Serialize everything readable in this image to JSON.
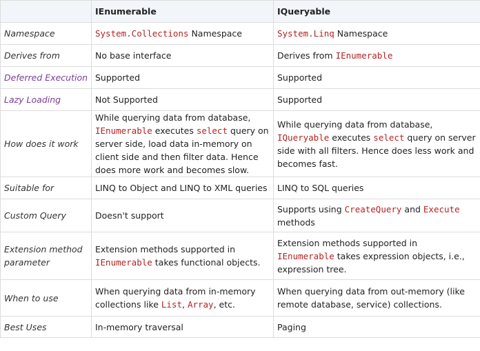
{
  "header": {
    "col0": "",
    "col1": "IEnumerable",
    "col2": "IQueryable"
  },
  "rows": [
    {
      "label": "Namespace",
      "c1": [
        {
          "t": "System.Collections",
          "code": true
        },
        {
          "t": " Namespace"
        }
      ],
      "c2": [
        {
          "t": "System.Linq",
          "code": true
        },
        {
          "t": " Namespace"
        }
      ]
    },
    {
      "label": "Derives from",
      "c1": [
        {
          "t": "No base interface"
        }
      ],
      "c2": [
        {
          "t": "Derives from "
        },
        {
          "t": "IEnumerable",
          "code": true
        }
      ]
    },
    {
      "label": "Deferred Execution",
      "c1": [
        {
          "t": "Supported"
        }
      ],
      "c2": [
        {
          "t": "Supported"
        }
      ]
    },
    {
      "label": "Lazy Loading",
      "c1": [
        {
          "t": "Not Supported"
        }
      ],
      "c2": [
        {
          "t": "Supported"
        }
      ]
    },
    {
      "label": "How does it work",
      "c1": [
        {
          "t": "While querying data from database, "
        },
        {
          "t": "IEnumerable",
          "code": true
        },
        {
          "t": " executes "
        },
        {
          "t": "select",
          "code": true
        },
        {
          "t": " query on server side, load data in-memory on client side and then filter data. Hence does more work and becomes slow."
        }
      ],
      "c2": [
        {
          "t": "While querying data from database, "
        },
        {
          "t": "IQueryable",
          "code": true
        },
        {
          "t": " executes "
        },
        {
          "t": "select",
          "code": true
        },
        {
          "t": " query on server side with all filters. Hence does less work and becomes fast."
        }
      ]
    },
    {
      "label": "Suitable for",
      "c1": [
        {
          "t": "LINQ to Object and LINQ to XML queries"
        }
      ],
      "c2": [
        {
          "t": "LINQ to SQL queries"
        }
      ]
    },
    {
      "label": "Custom Query",
      "c1": [
        {
          "t": "Doesn't support"
        }
      ],
      "c2": [
        {
          "t": "Supports using "
        },
        {
          "t": "CreateQuery",
          "code": true
        },
        {
          "t": " and "
        },
        {
          "t": "Execute",
          "code": true
        },
        {
          "t": " methods"
        }
      ]
    },
    {
      "label": "Extension method parameter",
      "c1": [
        {
          "t": "Extension methods supported in "
        },
        {
          "t": "IEnumerable",
          "code": true
        },
        {
          "t": " takes functional objects."
        }
      ],
      "c2": [
        {
          "t": "Extension methods supported in "
        },
        {
          "t": "IEnumerable",
          "code": true
        },
        {
          "t": " takes expression objects, i.e., expression tree."
        }
      ]
    },
    {
      "label": "When to use",
      "c1": [
        {
          "t": "When querying data from in-memory collections like "
        },
        {
          "t": "List",
          "code": true
        },
        {
          "t": ", "
        },
        {
          "t": "Array",
          "code": true
        },
        {
          "t": ", etc."
        }
      ],
      "c2": [
        {
          "t": "When querying data from out-memory (like remote database, service) collections."
        }
      ]
    },
    {
      "label": "Best Uses",
      "c1": [
        {
          "t": "In-memory traversal"
        }
      ],
      "c2": [
        {
          "t": "Paging"
        }
      ]
    }
  ]
}
